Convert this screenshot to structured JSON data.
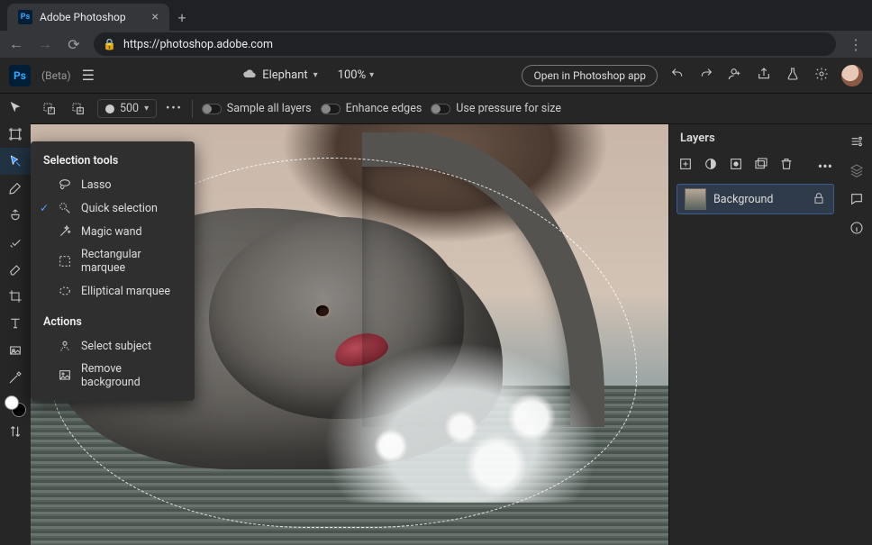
{
  "browser": {
    "tab_title": "Adobe Photoshop",
    "url": "https://photoshop.adobe.com"
  },
  "header": {
    "beta_label": "(Beta)",
    "doc_name": "Elephant",
    "zoom": "100%",
    "open_in_app": "Open in Photoshop app"
  },
  "options": {
    "brush_size": "500",
    "sample_all": "Sample all layers",
    "enhance_edges": "Enhance edges",
    "pressure": "Use pressure for size"
  },
  "flyout": {
    "section_tools": "Selection tools",
    "lasso": "Lasso",
    "quick_selection": "Quick selection",
    "magic_wand": "Magic wand",
    "rect_marquee": "Rectangular marquee",
    "ellipse_marquee": "Elliptical marquee",
    "section_actions": "Actions",
    "select_subject": "Select subject",
    "remove_bg": "Remove background"
  },
  "layers": {
    "title": "Layers",
    "layer0": "Background"
  }
}
